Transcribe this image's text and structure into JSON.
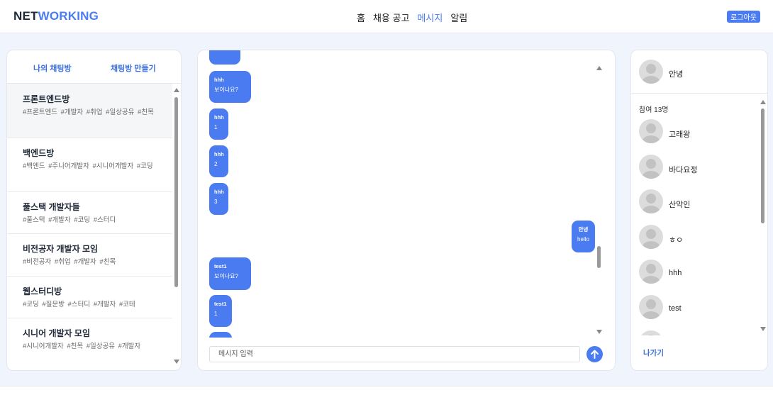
{
  "header": {
    "logo_part1": "NET",
    "logo_part2": "WORKING",
    "nav": [
      "홈",
      "채용 공고",
      "메시지",
      "알림"
    ],
    "active_nav": "메시지",
    "logout_label": "로그아웃"
  },
  "left_panel": {
    "tab_my_rooms": "나의 채팅방",
    "tab_create_room": "채팅방 만들기",
    "rooms": [
      {
        "name": "프론트엔드방",
        "tags": "#프론트엔드  #개발자  #취업  #일상공유  #친목"
      },
      {
        "name": "백엔드방",
        "tags": "#백엔드  #주니어개발자  #시니어개발자  #코딩"
      },
      {
        "name": "풀스택 개발자들",
        "tags": "#풀스택  #개발자  #코딩  #스터디"
      },
      {
        "name": "비전공자 개발자 모임",
        "tags": "#비전공자  #취업  #개발자  #친목"
      },
      {
        "name": "웹스터디방",
        "tags": "#코딩  #질문방  #스터디  #개발자  #코테"
      },
      {
        "name": "시니어 개발자 모임",
        "tags": "#시니어개발자  #친목  #일상공유  #개발자"
      }
    ]
  },
  "chat": {
    "messages": [
      {
        "sender": "hhh",
        "text": "보이나요?",
        "side": "left"
      },
      {
        "sender": "hhh",
        "text": "1",
        "side": "left"
      },
      {
        "sender": "hhh",
        "text": "2",
        "side": "left"
      },
      {
        "sender": "hhh",
        "text": "3",
        "side": "left"
      },
      {
        "sender": "안녕",
        "text": "hello",
        "side": "right"
      },
      {
        "sender": "test1",
        "text": "보이나요?",
        "side": "left"
      },
      {
        "sender": "test1",
        "text": "1",
        "side": "left"
      }
    ],
    "input_placeholder": "메시지 입력"
  },
  "right_panel": {
    "me": "안녕",
    "participant_count": "참여 13명",
    "participants": [
      "고래왕",
      "바다요정",
      "산악인",
      "ㅎㅇ",
      "hhh",
      "test"
    ],
    "leave_label": "나가기"
  },
  "colors": {
    "accent": "#4a7bf0",
    "page_bg": "#f0f4fc"
  }
}
